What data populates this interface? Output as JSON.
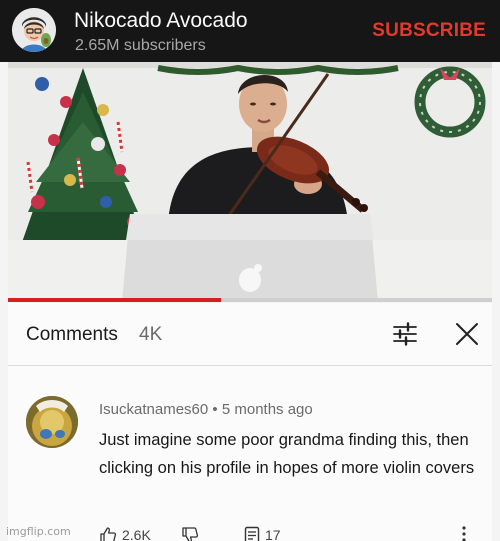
{
  "channel": {
    "name": "Nikocado Avocado",
    "subscribers": "2.65M subscribers",
    "subscribe_label": "SUBSCRIBE"
  },
  "video": {
    "progress_fraction": 0.44,
    "progress_color": "#d51f1f"
  },
  "comments_header": {
    "title": "Comments",
    "count": "4K",
    "sort_icon": "sort-filter-icon",
    "close_icon": "close-icon"
  },
  "comment": {
    "author": "Isuckatnames60",
    "separator": "•",
    "age": "5 months ago",
    "text": "Just imagine some poor grandma finding this, then clicking on his profile in hopes of more violin covers",
    "likes": "2.6K",
    "replies": "17",
    "like_icon": "thumbs-up-icon",
    "dislike_icon": "thumbs-down-icon",
    "reply_icon": "reply-comment-icon",
    "more_icon": "more-vertical-icon"
  },
  "watermark": "imgflip.com",
  "colors": {
    "header_bg": "#161616",
    "subscribe": "#e2392c"
  }
}
